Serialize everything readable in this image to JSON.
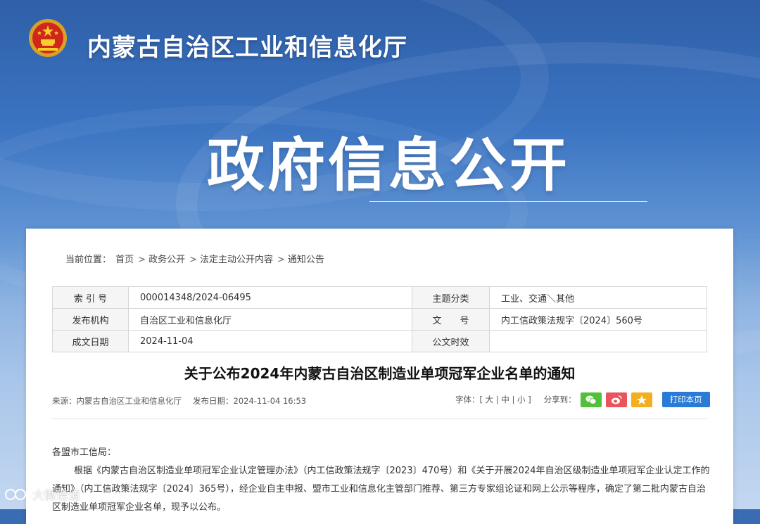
{
  "header": {
    "site_title": "内蒙古自治区工业和信息化厅",
    "hero_title": "政府信息公开"
  },
  "breadcrumb": {
    "prefix": "当前位置：",
    "items": [
      "首页",
      "政务公开",
      "法定主动公开内容",
      "通知公告"
    ],
    "separator": ">"
  },
  "meta_table": {
    "rows": [
      {
        "l1": "索 引 号",
        "v1": "000014348/2024-06495",
        "l2": "主题分类",
        "v2": "工业、交通＼其他"
      },
      {
        "l1": "发布机构",
        "v1": "自治区工业和信息化厅",
        "l2": "文　　号",
        "v2": "内工信政策法规字〔2024〕560号"
      },
      {
        "l1": "成文日期",
        "v1": "2024-11-04",
        "l2": "公文时效",
        "v2": ""
      }
    ]
  },
  "article": {
    "title": "关于公布2024年内蒙古自治区制造业单项冠军企业名单的通知",
    "source": "来源：内蒙古自治区工业和信息化厅",
    "publish_date": "发布日期：2024-11-04 16:53",
    "font_label": "字体：",
    "font_open": "[",
    "font_large": "大",
    "font_medium": "中",
    "font_small": "小",
    "font_close": "]",
    "font_sep": "|",
    "share_label": "分享到：",
    "print_label": "打印本页",
    "salutation": "各盟市工信局：",
    "paragraph": "根据《内蒙古自治区制造业单项冠军企业认定管理办法》（内工信政策法规字〔2023〕470号）和《关于开展2024年自治区级制造业单项冠军企业认定工作的通知》（内工信政策法规字〔2024〕365号），经企业自主申报、盟市工业和信息化主管部门推荐、第三方专家组论证和网上公示等程序，确定了第二批内蒙古自治区制造业单项冠军企业名单，现予以公布。"
  },
  "share_buttons": [
    {
      "icon": "wechat-icon",
      "color": "#52c03a"
    },
    {
      "icon": "weibo-icon",
      "color": "#e9555b"
    },
    {
      "icon": "star-icon",
      "color": "#f2b020"
    }
  ],
  "colors": {
    "print_button": "#2a7bd6",
    "banner_top": "#2f5fa8"
  },
  "watermark": {
    "text": "大微倍道"
  }
}
